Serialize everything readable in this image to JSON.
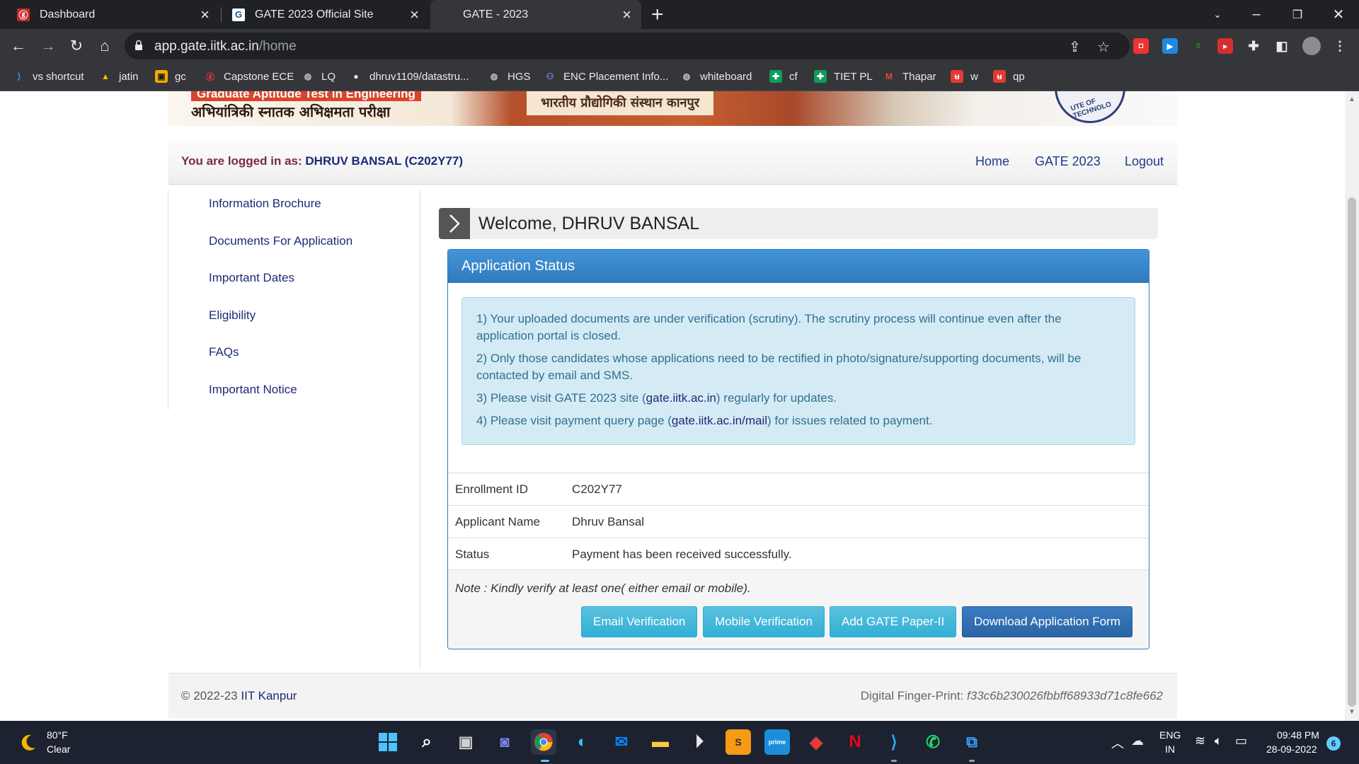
{
  "browser": {
    "tabs": [
      {
        "title": "Dashboard",
        "active": false
      },
      {
        "title": "GATE 2023 Official Site",
        "active": false
      },
      {
        "title": "GATE - 2023",
        "active": true
      }
    ],
    "url_host": "app.gate.iitk.ac.in",
    "url_path": "/home",
    "bookmarks": [
      "vs shortcut",
      "jatin",
      "gc",
      "Capstone ECE",
      "LQ",
      "dhruv1109/datastru...",
      "HGS",
      "ENC Placement Info...",
      "whiteboard",
      "cf",
      "TIET PL",
      "Thapar",
      "w",
      "qp"
    ]
  },
  "banner": {
    "title_en": "Graduate Aptitude Test in Engineering",
    "title_hi": "अभियांत्रिकी स्नातक अभिक्षमता परीक्षा",
    "institute_hi": "भारतीय प्रौद्योगिकी संस्थान कानपुर",
    "seal_text": "UTE OF TECHNOLO"
  },
  "header": {
    "logged_prefix": "You are logged in as:",
    "user": "DHRUV BANSAL (C202Y77)",
    "links": [
      "Home",
      "GATE 2023",
      "Logout"
    ]
  },
  "sidebar": {
    "items": [
      "Information Brochure",
      "Documents For Application",
      "Important Dates",
      "Eligibility",
      "FAQs",
      "Important Notice"
    ]
  },
  "main": {
    "welcome": "Welcome, DHRUV BANSAL",
    "panel_title": "Application Status",
    "alert": {
      "l1": "1) Your uploaded documents are under verification (scrutiny). The scrutiny process will continue even after the application portal is closed.",
      "l2": "2) Only those candidates whose applications need to be rectified in photo/signature/supporting documents, will be contacted by email and SMS.",
      "l3_a": "3) Please visit GATE 2023 site (",
      "l3_link": "gate.iitk.ac.in",
      "l3_b": ") regularly for updates.",
      "l4_a": "4) Please visit payment query page (",
      "l4_link": "gate.iitk.ac.in/mail",
      "l4_b": ") for issues related to payment."
    },
    "rows": [
      {
        "label": "Enrollment ID",
        "value": "C202Y77"
      },
      {
        "label": "Applicant Name",
        "value": "Dhruv Bansal"
      },
      {
        "label": "Status",
        "value": "Payment has been received successfully."
      }
    ],
    "note": "Note : Kindly verify at least one( either email or mobile).",
    "buttons": {
      "email": "Email Verification",
      "mobile": "Mobile Verification",
      "paper2": "Add GATE Paper-II",
      "download": "Download Application Form"
    }
  },
  "footer": {
    "copy": "© 2022-23",
    "org": "IIT Kanpur",
    "fp_label": "Digital Finger-Print:",
    "fp_value": "f33c6b230026fbbff68933d71c8fe662"
  },
  "taskbar": {
    "temp": "80°F",
    "condition": "Clear",
    "lang1": "ENG",
    "lang2": "IN",
    "time": "09:48 PM",
    "date": "28-09-2022",
    "notifications": "6"
  },
  "colors": {
    "panel_blue": "#337ab7",
    "link_navy": "#1e2a78",
    "alert_bg": "#d4ebf5",
    "info_btn": "#5bc0de"
  }
}
